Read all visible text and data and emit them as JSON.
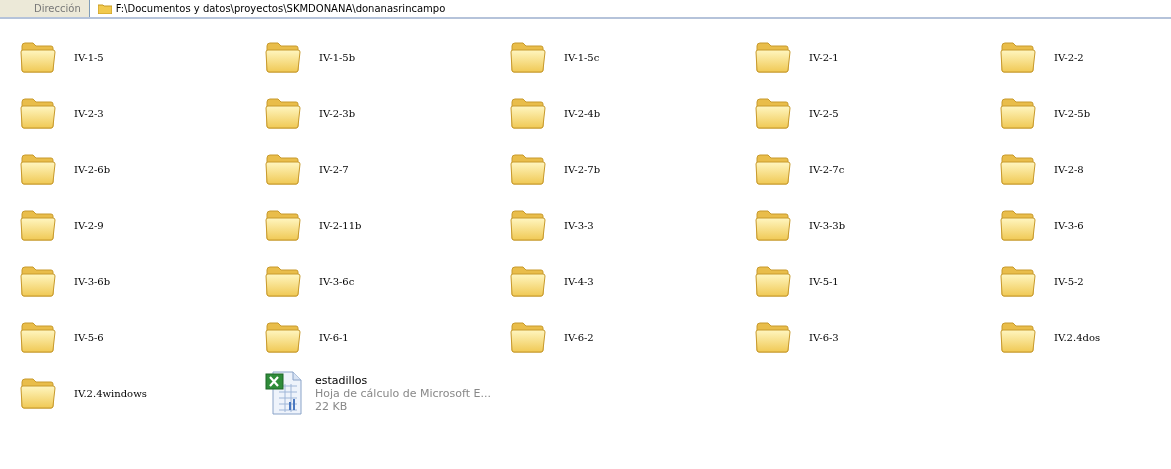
{
  "address_bar": {
    "label": "Dirección",
    "path": "F:\\Documentos y datos\\proyectos\\SKMDONANA\\donanasrincampo"
  },
  "items": [
    {
      "kind": "folder",
      "name": "IV-1-5"
    },
    {
      "kind": "folder",
      "name": "IV-1-5b"
    },
    {
      "kind": "folder",
      "name": "IV-1-5c"
    },
    {
      "kind": "folder",
      "name": "IV-2-1"
    },
    {
      "kind": "folder",
      "name": "IV-2-2"
    },
    {
      "kind": "folder",
      "name": "IV-2-3"
    },
    {
      "kind": "folder",
      "name": "IV-2-3b"
    },
    {
      "kind": "folder",
      "name": "IV-2-4b"
    },
    {
      "kind": "folder",
      "name": "IV-2-5"
    },
    {
      "kind": "folder",
      "name": "IV-2-5b"
    },
    {
      "kind": "folder",
      "name": "IV-2-6b"
    },
    {
      "kind": "folder",
      "name": "IV-2-7"
    },
    {
      "kind": "folder",
      "name": "IV-2-7b"
    },
    {
      "kind": "folder",
      "name": "IV-2-7c"
    },
    {
      "kind": "folder",
      "name": "IV-2-8"
    },
    {
      "kind": "folder",
      "name": "IV-2-9"
    },
    {
      "kind": "folder",
      "name": "IV-2-11b"
    },
    {
      "kind": "folder",
      "name": "IV-3-3"
    },
    {
      "kind": "folder",
      "name": "IV-3-3b"
    },
    {
      "kind": "folder",
      "name": "IV-3-6"
    },
    {
      "kind": "folder",
      "name": "IV-3-6b"
    },
    {
      "kind": "folder",
      "name": "IV-3-6c"
    },
    {
      "kind": "folder",
      "name": "IV-4-3"
    },
    {
      "kind": "folder",
      "name": "IV-5-1"
    },
    {
      "kind": "folder",
      "name": "IV-5-2"
    },
    {
      "kind": "folder",
      "name": "IV-5-6"
    },
    {
      "kind": "folder",
      "name": "IV-6-1"
    },
    {
      "kind": "folder",
      "name": "IV-6-2"
    },
    {
      "kind": "folder",
      "name": "IV-6-3"
    },
    {
      "kind": "folder",
      "name": "IV.2.4dos"
    },
    {
      "kind": "folder",
      "name": "IV.2.4windows"
    },
    {
      "kind": "spreadsheet",
      "name": "estadillos",
      "type": "Hoja de cálculo de Microsoft E...",
      "size": "22 KB"
    }
  ]
}
